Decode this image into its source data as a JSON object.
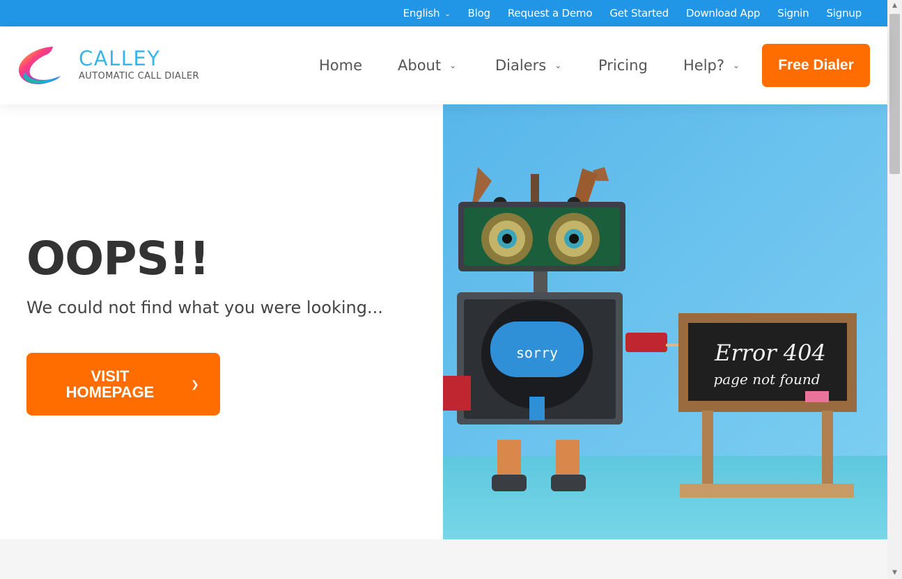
{
  "topbar": {
    "language": "English",
    "links": [
      "Blog",
      "Request a Demo",
      "Get Started",
      "Download App",
      "Signin",
      "Signup"
    ]
  },
  "brand": {
    "name": "CALLEY",
    "tagline": "AUTOMATIC CALL DIALER"
  },
  "nav": {
    "home": "Home",
    "about": "About",
    "dialers": "Dialers",
    "pricing": "Pricing",
    "help": "Help?",
    "cta": "Free Dialer"
  },
  "hero": {
    "title": "OOPS!!",
    "subtitle": "We could not find what you were looking...",
    "button_line1": "VISIT",
    "button_line2": "HOMEPAGE",
    "image": {
      "robot_screen": "sorry",
      "board_line1": "Error 404",
      "board_line2": "page not found"
    }
  },
  "colors": {
    "topbar": "#2196e6",
    "accent": "#ff6d00",
    "brand_blue": "#38b6ea"
  },
  "icons": {
    "dropdown": "chevron-down-icon",
    "button_arrow": "chevron-right-icon"
  }
}
